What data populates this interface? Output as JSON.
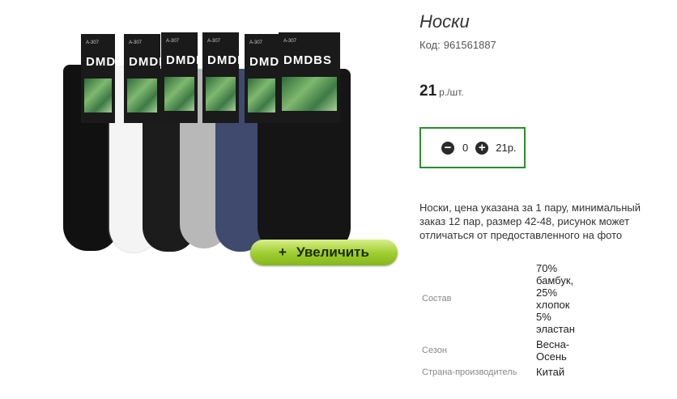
{
  "product": {
    "title": "Носки",
    "code_label": "Код:",
    "code_value": "961561887",
    "price_value": "21",
    "price_unit": "р./шт.",
    "description": "Носки, цена указана за 1 пару, минимальный заказ 12 пар, размер 42-48, рисунок может отличаться от предоставленного на фото"
  },
  "image": {
    "brand_text": "DMDBS",
    "tag_codes": [
      "A-307",
      "A-307",
      "A-307",
      "A-307",
      "A-307",
      "A-307"
    ],
    "zoom_button": {
      "icon": "+",
      "label": "Увеличить"
    },
    "sock_colors": [
      "#111111",
      "#f4f4f4",
      "#1c1c1c",
      "#b8b8b8",
      "#3f4a6e",
      "#151515"
    ]
  },
  "quantity": {
    "minus_icon": "−",
    "value": "0",
    "plus_icon": "+",
    "total": "21р."
  },
  "properties": [
    {
      "label": "Состав",
      "value": "70% бамбук, 25% хлопок 5% эластан"
    },
    {
      "label": "Сезон",
      "value": "Весна-Осень"
    },
    {
      "label": "Страна-производитель",
      "value": "Китай"
    }
  ],
  "colors": {
    "qty_border": "#2e8b2e",
    "zoom_button": "#9ccc2d"
  }
}
